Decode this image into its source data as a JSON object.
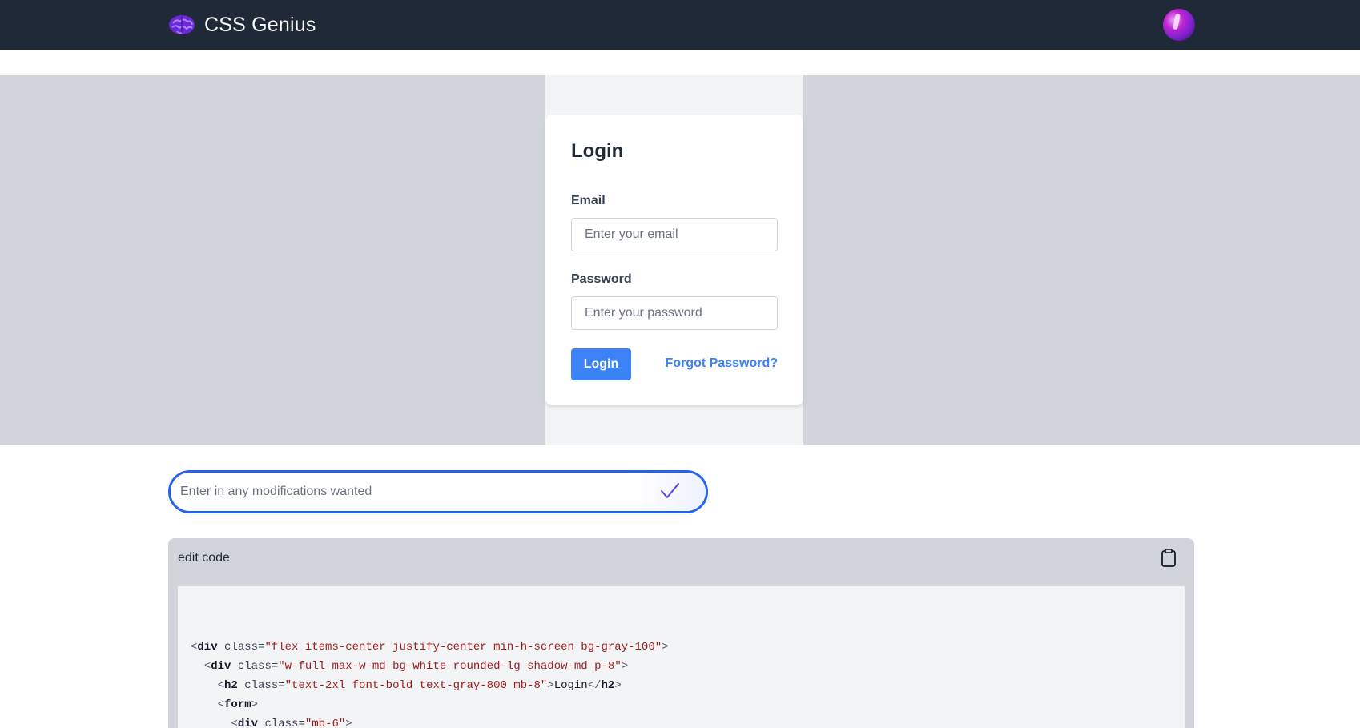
{
  "nav": {
    "brand_name": "CSS Genius",
    "brand_icon": "brain-icon",
    "avatar_icon": "user-avatar"
  },
  "preview": {
    "card_title": "Login",
    "email_label": "Email",
    "email_placeholder": "Enter your email",
    "password_label": "Password",
    "password_placeholder": "Enter your password",
    "login_button": "Login",
    "forgot_link": "Forgot Password?"
  },
  "modify": {
    "placeholder": "Enter in any modifications wanted",
    "submit_icon": "checkmark-icon"
  },
  "code_panel": {
    "title": "edit code",
    "copy_icon": "clipboard-icon",
    "lines": [
      {
        "indent": "",
        "open": "<",
        "tag": "div",
        "attr": " class=",
        "value": "\"flex items-center justify-center min-h-screen bg-gray-100\"",
        "close": ">",
        "text": "",
        "end_open": "",
        "end_tag": "",
        "end_close": ""
      },
      {
        "indent": "  ",
        "open": "<",
        "tag": "div",
        "attr": " class=",
        "value": "\"w-full max-w-md bg-white rounded-lg shadow-md p-8\"",
        "close": ">",
        "text": "",
        "end_open": "",
        "end_tag": "",
        "end_close": ""
      },
      {
        "indent": "    ",
        "open": "<",
        "tag": "h2",
        "attr": " class=",
        "value": "\"text-2xl font-bold text-gray-800 mb-8\"",
        "close": ">",
        "text": "Login",
        "end_open": "</",
        "end_tag": "h2",
        "end_close": ">"
      },
      {
        "indent": "    ",
        "open": "<",
        "tag": "form",
        "attr": "",
        "value": "",
        "close": ">",
        "text": "",
        "end_open": "",
        "end_tag": "",
        "end_close": ""
      },
      {
        "indent": "      ",
        "open": "<",
        "tag": "div",
        "attr": " class=",
        "value": "\"mb-6\"",
        "close": ">",
        "text": "",
        "end_open": "",
        "end_tag": "",
        "end_close": ""
      }
    ]
  },
  "colors": {
    "nav_bg": "#1f2937",
    "accent": "#3b82f6",
    "focus_ring": "#2563eb",
    "code_string": "#a11d1d"
  }
}
